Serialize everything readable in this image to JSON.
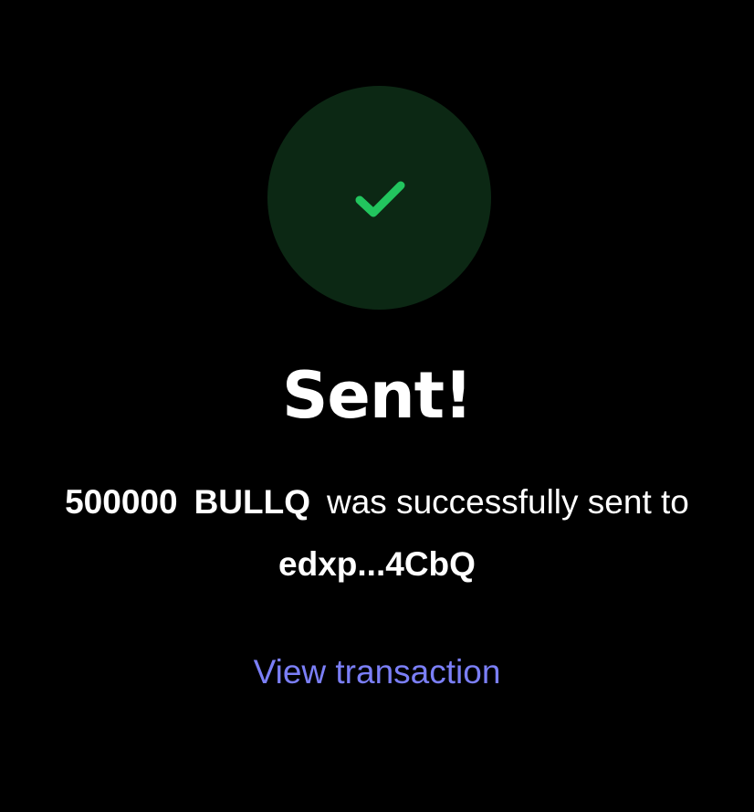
{
  "status": {
    "icon": "checkmark-icon",
    "circle_color": "#0c2814",
    "check_color": "#22c55e"
  },
  "title": "Sent!",
  "message": {
    "amount": "500000",
    "token": "BULLQ",
    "text": "was successfully sent to",
    "recipient": "edxp...4CbQ"
  },
  "link": {
    "label": "View transaction",
    "color": "#7b7ff7"
  }
}
